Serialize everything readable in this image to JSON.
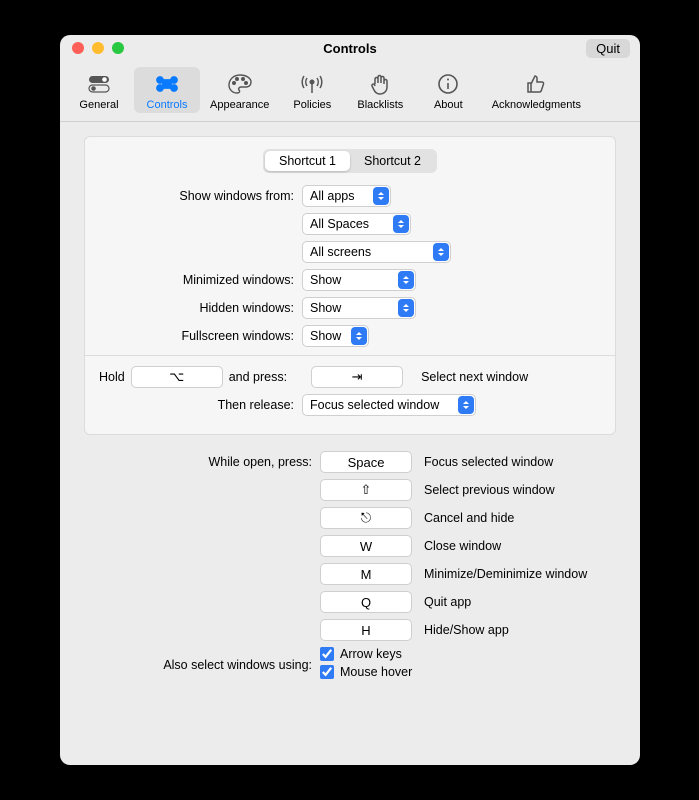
{
  "window": {
    "title": "Controls",
    "quit": "Quit"
  },
  "toolbar": {
    "items": [
      {
        "label": "General"
      },
      {
        "label": "Controls"
      },
      {
        "label": "Appearance"
      },
      {
        "label": "Policies"
      },
      {
        "label": "Blacklists"
      },
      {
        "label": "About"
      },
      {
        "label": "Acknowledgments"
      }
    ]
  },
  "seg": {
    "a": "Shortcut 1",
    "b": "Shortcut 2"
  },
  "labels": {
    "showFrom": "Show windows from:",
    "minimized": "Minimized windows:",
    "hidden": "Hidden windows:",
    "fullscreen": "Fullscreen windows:",
    "hold": "Hold",
    "andPress": "and press:",
    "thenRelease": "Then release:",
    "whileOpen": "While open, press:",
    "alsoSelect": "Also select windows using:"
  },
  "selects": {
    "apps": "All apps",
    "spaces": "All Spaces",
    "screens": "All screens",
    "minimized": "Show",
    "hidden": "Show",
    "fullscreen": "Show",
    "thenRelease": "Focus selected window"
  },
  "keys": {
    "hold": "⌥",
    "press": "⇥",
    "space": "Space",
    "prev": "⇧",
    "cancel": "⎋",
    "close": "W",
    "min": "M",
    "quit": "Q",
    "hide": "H"
  },
  "desc": {
    "next": "Select next window",
    "focus": "Focus selected window",
    "prev": "Select previous window",
    "cancel": "Cancel and hide",
    "close": "Close window",
    "min": "Minimize/Deminimize window",
    "quit": "Quit app",
    "hide": "Hide/Show app"
  },
  "checks": {
    "arrows": "Arrow keys",
    "hover": "Mouse hover"
  }
}
